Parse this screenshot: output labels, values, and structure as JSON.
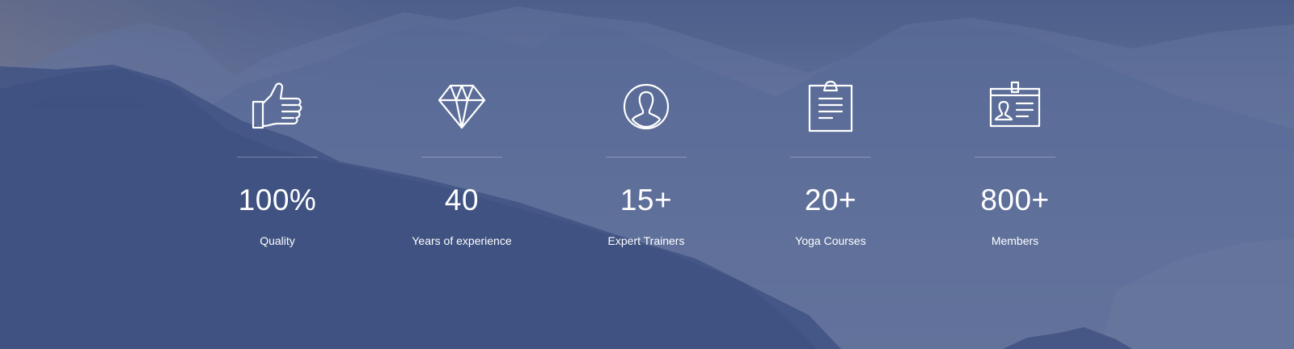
{
  "theme": {
    "text_color": "#ffffff",
    "overlay_color": "#4a5d8c"
  },
  "stats": [
    {
      "icon": "thumbs-up-icon",
      "value": "100%",
      "label": "Quality"
    },
    {
      "icon": "diamond-icon",
      "value": "40",
      "label": "Years of experience"
    },
    {
      "icon": "user-circle-icon",
      "value": "15+",
      "label": "Expert Trainers"
    },
    {
      "icon": "clipboard-icon",
      "value": "20+",
      "label": "Yoga Courses"
    },
    {
      "icon": "id-badge-icon",
      "value": "800+",
      "label": "Members"
    }
  ]
}
